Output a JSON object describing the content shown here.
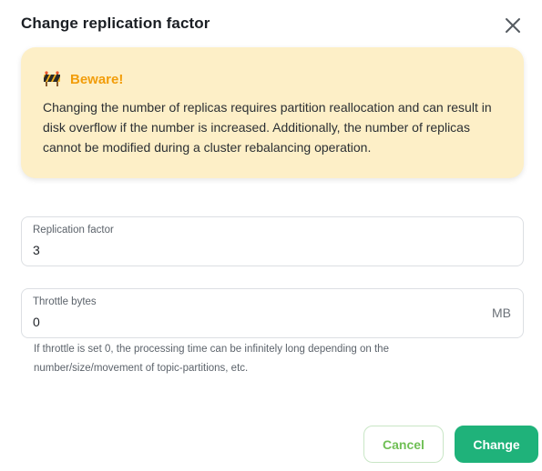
{
  "dialog": {
    "title": "Change replication factor",
    "close_icon": "close-icon"
  },
  "warning": {
    "icon": "construction-barrier-icon",
    "title": "Beware!",
    "text": "Changing the number of replicas requires partition reallocation and can result in disk overflow if the number is increased. Additionally, the number of replicas cannot be modified during a cluster rebalancing operation.",
    "title_color": "#f29d0a",
    "background_color": "#fdefc7"
  },
  "replication_factor": {
    "label": "Replication factor",
    "value": "3"
  },
  "throttle": {
    "label": "Throttle bytes",
    "value": "0",
    "unit": "MB",
    "helper": "If throttle is set 0, the processing time can be infinitely long depending on the number/size/movement of topic-partitions, etc."
  },
  "actions": {
    "cancel_label": "Cancel",
    "change_label": "Change",
    "accent_color": "#1fb27a"
  }
}
